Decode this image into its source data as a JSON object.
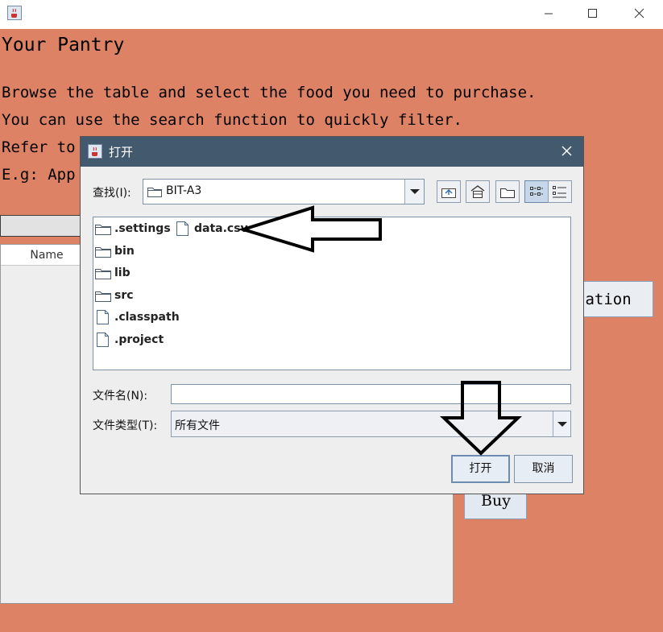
{
  "window": {
    "icon": "java-coffee-icon",
    "controls": [
      "minimize-icon",
      "maximize-icon",
      "close-icon"
    ]
  },
  "main": {
    "title": "Your Pantry",
    "instructions": [
      "Browse the table and select the food you need to purchase.",
      "You can use the search function to quickly filter.",
      "Refer to",
      "E.g: App"
    ],
    "table": {
      "columns": [
        "Name"
      ]
    },
    "info_button_label": "nation",
    "buy_label": "Buy"
  },
  "dialog": {
    "title": "打开",
    "look_in_label": "查找(I):",
    "look_in_value": "BIT-A3",
    "toolbar": [
      "up-one-level-icon",
      "home-icon",
      "new-folder-icon",
      "list-view-icon",
      "details-view-icon"
    ],
    "files": [
      {
        "name": ".settings",
        "type": "folder"
      },
      {
        "name": "bin",
        "type": "folder"
      },
      {
        "name": "lib",
        "type": "folder"
      },
      {
        "name": "src",
        "type": "folder"
      },
      {
        "name": ".classpath",
        "type": "file"
      },
      {
        "name": ".project",
        "type": "file"
      },
      {
        "name": "data.csv",
        "type": "file"
      }
    ],
    "file_name_label": "文件名(N):",
    "file_name_value": "",
    "file_type_label": "文件类型(T):",
    "file_type_value": "所有文件",
    "open_label": "打开",
    "cancel_label": "取消"
  },
  "colors": {
    "background": "#dd8265",
    "dialog_title": "#435a6e",
    "dialog_body": "#eeeeee"
  }
}
